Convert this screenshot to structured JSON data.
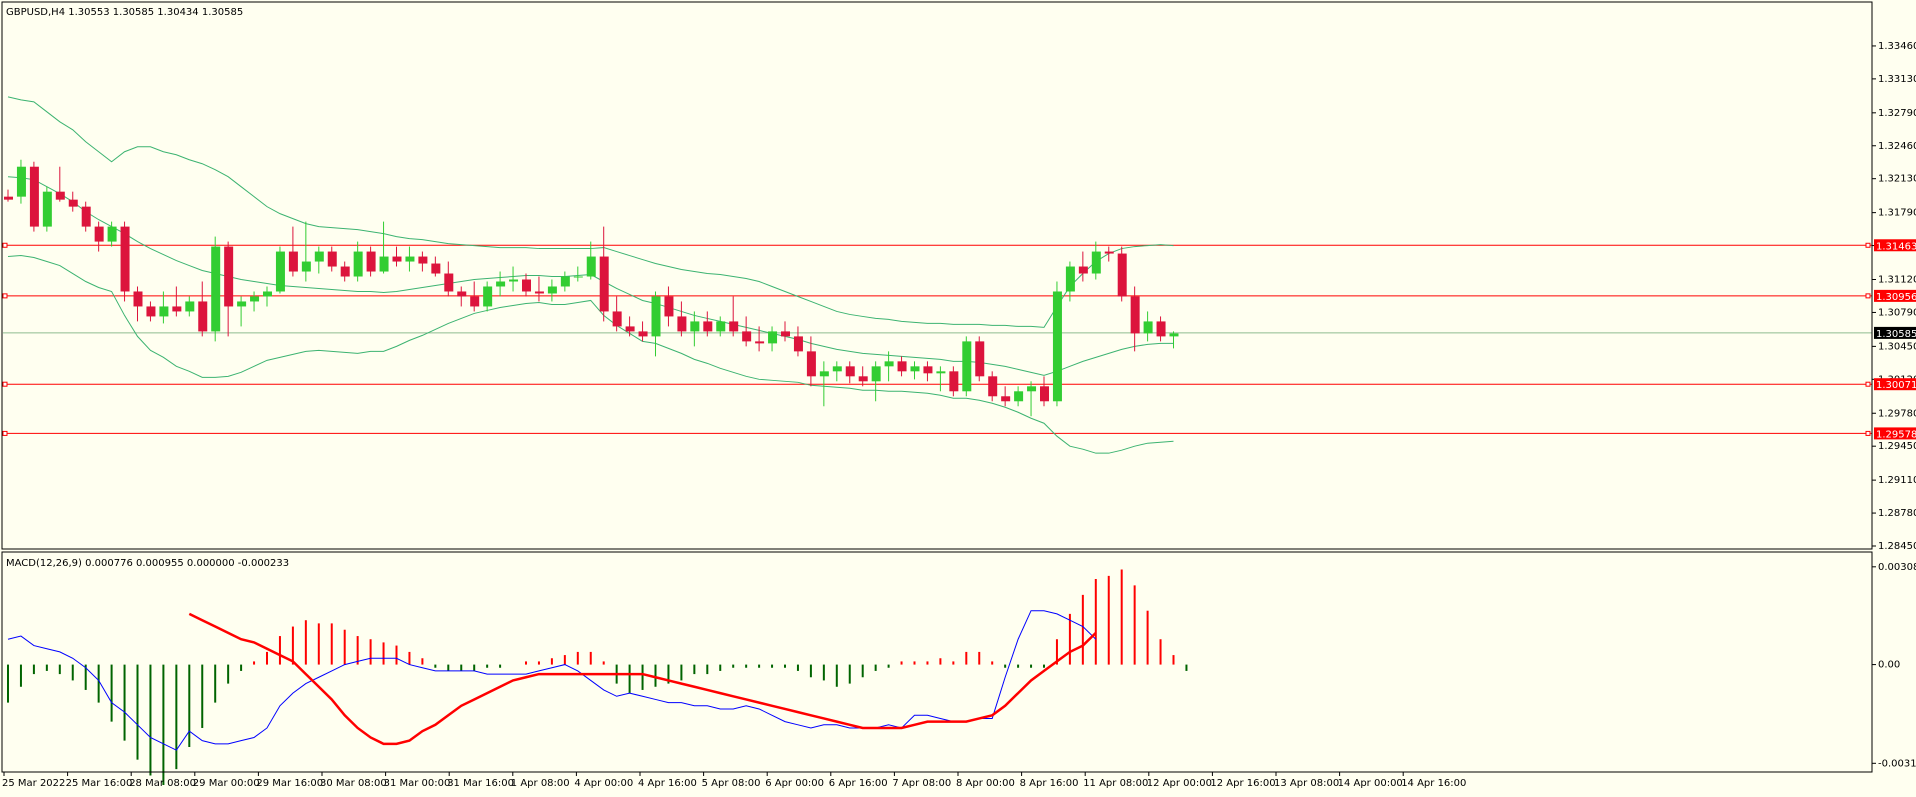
{
  "header": {
    "symbol_line": "GBPUSD,H4  1.30553 1.30585 1.30434 1.30585",
    "macd_line": "MACD(12,26,9) 0.000776 0.000955 0.000000 -0.000233"
  },
  "colors": {
    "background": "#fffff0",
    "frame": "#000000",
    "bull": "#32cd32",
    "bear": "#dc143c",
    "bands": "#3cb371",
    "hline": "#ff0000",
    "bid_line": "#8fbc8f",
    "macd_main": "#0000ff",
    "macd_signal": "#ff0000",
    "hist_down": "#006400",
    "hist_up": "#ff0000"
  },
  "chart_data": [
    {
      "type": "candlestick",
      "title": "GBPUSD,H4",
      "ohlc_header": "1.30553 1.30585 1.30434 1.30585",
      "ylim": [
        1.2845,
        1.3375
      ],
      "y_ticks": [
        "1.33460",
        "1.33130",
        "1.32790",
        "1.32460",
        "1.32130",
        "1.31790",
        "1.31460",
        "1.31120",
        "1.30790",
        "1.30450",
        "1.30120",
        "1.29780",
        "1.29450",
        "1.29110",
        "1.28780",
        "1.28450"
      ],
      "x_ticks": [
        "25 Mar 2022",
        "25 Mar 16:00",
        "28 Mar 08:00",
        "29 Mar 00:00",
        "29 Mar 16:00",
        "30 Mar 08:00",
        "31 Mar 00:00",
        "31 Mar 16:00",
        "1 Apr 08:00",
        "4 Apr 00:00",
        "4 Apr 16:00",
        "5 Apr 08:00",
        "6 Apr 00:00",
        "6 Apr 16:00",
        "7 Apr 08:00",
        "8 Apr 00:00",
        "8 Apr 16:00",
        "11 Apr 08:00",
        "12 Apr 00:00",
        "12 Apr 16:00",
        "13 Apr 08:00",
        "14 Apr 00:00",
        "14 Apr 16:00"
      ],
      "current_price": "1.30585",
      "horizontal_levels": [
        "1.31463",
        "1.30956",
        "1.30071",
        "1.29578"
      ],
      "candles": [
        [
          1.3195,
          1.3202,
          1.319,
          1.3192
        ],
        [
          1.3195,
          1.3232,
          1.3188,
          1.3225
        ],
        [
          1.3225,
          1.323,
          1.316,
          1.3165
        ],
        [
          1.3165,
          1.3205,
          1.316,
          1.32
        ],
        [
          1.32,
          1.3225,
          1.319,
          1.3192
        ],
        [
          1.3192,
          1.32,
          1.318,
          1.3185
        ],
        [
          1.3185,
          1.319,
          1.316,
          1.3165
        ],
        [
          1.3165,
          1.317,
          1.314,
          1.315
        ],
        [
          1.315,
          1.317,
          1.3145,
          1.3165
        ],
        [
          1.3165,
          1.317,
          1.309,
          1.31
        ],
        [
          1.31,
          1.3105,
          1.307,
          1.3085
        ],
        [
          1.3085,
          1.309,
          1.307,
          1.3075
        ],
        [
          1.3075,
          1.31,
          1.3068,
          1.3085
        ],
        [
          1.3085,
          1.3105,
          1.3075,
          1.308
        ],
        [
          1.308,
          1.3095,
          1.3075,
          1.309
        ],
        [
          1.309,
          1.311,
          1.3055,
          1.306
        ],
        [
          1.306,
          1.3155,
          1.305,
          1.3145
        ],
        [
          1.3145,
          1.315,
          1.3055,
          1.3085
        ],
        [
          1.3085,
          1.3095,
          1.3065,
          1.309
        ],
        [
          1.309,
          1.31,
          1.308,
          1.3095
        ],
        [
          1.3095,
          1.3105,
          1.3085,
          1.31
        ],
        [
          1.31,
          1.3145,
          1.3098,
          1.314
        ],
        [
          1.314,
          1.3165,
          1.3115,
          1.312
        ],
        [
          1.312,
          1.317,
          1.311,
          1.313
        ],
        [
          1.313,
          1.3145,
          1.3118,
          1.314
        ],
        [
          1.314,
          1.3145,
          1.312,
          1.3125
        ],
        [
          1.3125,
          1.313,
          1.311,
          1.3115
        ],
        [
          1.3115,
          1.315,
          1.311,
          1.314
        ],
        [
          1.314,
          1.3145,
          1.3115,
          1.312
        ],
        [
          1.312,
          1.317,
          1.3118,
          1.3135
        ],
        [
          1.3135,
          1.3145,
          1.3125,
          1.313
        ],
        [
          1.313,
          1.3145,
          1.312,
          1.3135
        ],
        [
          1.3135,
          1.314,
          1.312,
          1.3128
        ],
        [
          1.3128,
          1.3135,
          1.3115,
          1.3118
        ],
        [
          1.3118,
          1.313,
          1.3095,
          1.31
        ],
        [
          1.31,
          1.3105,
          1.3085,
          1.3095
        ],
        [
          1.3095,
          1.311,
          1.308,
          1.3085
        ],
        [
          1.3085,
          1.311,
          1.308,
          1.3105
        ],
        [
          1.3105,
          1.312,
          1.3095,
          1.311
        ],
        [
          1.311,
          1.3125,
          1.31,
          1.3112
        ],
        [
          1.3112,
          1.3118,
          1.3095,
          1.31
        ],
        [
          1.31,
          1.3115,
          1.309,
          1.3098
        ],
        [
          1.3098,
          1.3112,
          1.309,
          1.3105
        ],
        [
          1.3105,
          1.312,
          1.31,
          1.3115
        ],
        [
          1.3115,
          1.3125,
          1.311,
          1.3115
        ],
        [
          1.3115,
          1.315,
          1.3112,
          1.3135
        ],
        [
          1.3135,
          1.3165,
          1.307,
          1.308
        ],
        [
          1.308,
          1.3095,
          1.306,
          1.3065
        ],
        [
          1.3065,
          1.3075,
          1.3055,
          1.306
        ],
        [
          1.306,
          1.307,
          1.305,
          1.3055
        ],
        [
          1.3055,
          1.31,
          1.3035,
          1.3095
        ],
        [
          1.3095,
          1.3105,
          1.3065,
          1.3075
        ],
        [
          1.3075,
          1.309,
          1.3055,
          1.306
        ],
        [
          1.306,
          1.308,
          1.3045,
          1.307
        ],
        [
          1.307,
          1.308,
          1.3055,
          1.306
        ],
        [
          1.306,
          1.3075,
          1.3055,
          1.307
        ],
        [
          1.307,
          1.3095,
          1.3055,
          1.306
        ],
        [
          1.306,
          1.3075,
          1.3045,
          1.305
        ],
        [
          1.305,
          1.3065,
          1.304,
          1.3048
        ],
        [
          1.3048,
          1.3065,
          1.304,
          1.306
        ],
        [
          1.306,
          1.307,
          1.305,
          1.3055
        ],
        [
          1.3055,
          1.3065,
          1.3035,
          1.304
        ],
        [
          1.304,
          1.3055,
          1.3005,
          1.3015
        ],
        [
          1.3015,
          1.303,
          1.2985,
          1.302
        ],
        [
          1.302,
          1.303,
          1.301,
          1.3025
        ],
        [
          1.3025,
          1.303,
          1.3008,
          1.3015
        ],
        [
          1.3015,
          1.3025,
          1.3005,
          1.301
        ],
        [
          1.301,
          1.303,
          1.299,
          1.3025
        ],
        [
          1.3025,
          1.304,
          1.301,
          1.303
        ],
        [
          1.303,
          1.3035,
          1.3015,
          1.302
        ],
        [
          1.302,
          1.303,
          1.3012,
          1.3025
        ],
        [
          1.3025,
          1.303,
          1.301,
          1.3018
        ],
        [
          1.3018,
          1.3025,
          1.3,
          1.302
        ],
        [
          1.302,
          1.3025,
          1.2995,
          1.3
        ],
        [
          1.3,
          1.3055,
          1.2995,
          1.305
        ],
        [
          1.305,
          1.3055,
          1.301,
          1.3015
        ],
        [
          1.3015,
          1.302,
          1.299,
          1.2995
        ],
        [
          1.2995,
          1.3005,
          1.2985,
          1.299
        ],
        [
          1.299,
          1.3005,
          1.2985,
          1.3
        ],
        [
          1.3,
          1.301,
          1.2975,
          1.3005
        ],
        [
          1.3005,
          1.3015,
          1.2985,
          1.299
        ],
        [
          1.299,
          1.311,
          1.2985,
          1.31
        ],
        [
          1.31,
          1.313,
          1.309,
          1.3125
        ],
        [
          1.3125,
          1.314,
          1.311,
          1.3118
        ],
        [
          1.3118,
          1.315,
          1.3112,
          1.314
        ],
        [
          1.314,
          1.3145,
          1.313,
          1.3138
        ],
        [
          1.3138,
          1.3145,
          1.309,
          1.3095
        ],
        [
          1.3095,
          1.3105,
          1.304,
          1.3058
        ],
        [
          1.3058,
          1.308,
          1.305,
          1.307
        ],
        [
          1.307,
          1.3075,
          1.305,
          1.3055
        ],
        [
          1.3055,
          1.306,
          1.3043,
          1.3058
        ]
      ],
      "bands": {
        "upper": [
          1.3295,
          1.3292,
          1.329,
          1.328,
          1.327,
          1.3262,
          1.325,
          1.324,
          1.323,
          1.324,
          1.3245,
          1.3245,
          1.324,
          1.3237,
          1.3232,
          1.3228,
          1.3222,
          1.3215,
          1.3205,
          1.3195,
          1.3185,
          1.3178,
          1.3173,
          1.3168,
          1.3165,
          1.3164,
          1.3163,
          1.3162,
          1.316,
          1.3158,
          1.3155,
          1.3153,
          1.3152,
          1.315,
          1.3148,
          1.3147,
          1.3146,
          1.3145,
          1.3144,
          1.3144,
          1.3144,
          1.3143,
          1.3143,
          1.3143,
          1.3143,
          1.3143,
          1.3144,
          1.314,
          1.3136,
          1.3132,
          1.3128,
          1.3125,
          1.3122,
          1.312,
          1.3118,
          1.3117,
          1.3115,
          1.3113,
          1.311,
          1.3105,
          1.31,
          1.3095,
          1.309,
          1.3085,
          1.308,
          1.3077,
          1.3075,
          1.3073,
          1.3072,
          1.307,
          1.3069,
          1.3068,
          1.3068,
          1.3067,
          1.3067,
          1.3067,
          1.3066,
          1.3066,
          1.3065,
          1.3065,
          1.3064,
          1.3085,
          1.3105,
          1.3118,
          1.313,
          1.3138,
          1.3143,
          1.3145,
          1.3146,
          1.3147,
          1.3146
        ],
        "middle": [
          1.3215,
          1.3214,
          1.3212,
          1.3205,
          1.3198,
          1.319,
          1.318,
          1.3172,
          1.3165,
          1.3158,
          1.315,
          1.3143,
          1.3137,
          1.3131,
          1.3126,
          1.3121,
          1.3118,
          1.3115,
          1.3112,
          1.311,
          1.3108,
          1.3106,
          1.3105,
          1.3104,
          1.3103,
          1.3102,
          1.3101,
          1.31,
          1.31,
          1.3099,
          1.31,
          1.3102,
          1.3104,
          1.3106,
          1.3108,
          1.311,
          1.3112,
          1.3113,
          1.3114,
          1.3115,
          1.3116,
          1.3116,
          1.3115,
          1.3115,
          1.3116,
          1.3117,
          1.311,
          1.3103,
          1.3097,
          1.3091,
          1.3088,
          1.3084,
          1.308,
          1.3076,
          1.3073,
          1.307,
          1.3067,
          1.3064,
          1.3061,
          1.3058,
          1.3055,
          1.3052,
          1.3048,
          1.3045,
          1.3042,
          1.304,
          1.3038,
          1.3037,
          1.3036,
          1.3035,
          1.3034,
          1.3033,
          1.3032,
          1.303,
          1.303,
          1.3029,
          1.3027,
          1.3025,
          1.3022,
          1.3019,
          1.3016,
          1.302,
          1.3025,
          1.303,
          1.3034,
          1.3038,
          1.3042,
          1.3045,
          1.3047,
          1.3048,
          1.3048
        ],
        "lower": [
          1.3135,
          1.3136,
          1.3134,
          1.313,
          1.3126,
          1.3118,
          1.311,
          1.3104,
          1.31,
          1.3076,
          1.3055,
          1.3041,
          1.3034,
          1.3025,
          1.302,
          1.3014,
          1.3014,
          1.3015,
          1.3019,
          1.3025,
          1.3031,
          1.3034,
          1.3037,
          1.304,
          1.3041,
          1.304,
          1.3039,
          1.3038,
          1.304,
          1.304,
          1.3045,
          1.3051,
          1.3056,
          1.3062,
          1.3068,
          1.3073,
          1.3078,
          1.3081,
          1.3084,
          1.3086,
          1.3088,
          1.3089,
          1.3087,
          1.3087,
          1.3089,
          1.3091,
          1.3076,
          1.3066,
          1.3058,
          1.305,
          1.3048,
          1.3043,
          1.3038,
          1.3032,
          1.3028,
          1.3023,
          1.3019,
          1.3015,
          1.3012,
          1.3011,
          1.301,
          1.3009,
          1.3006,
          1.3005,
          1.3004,
          1.3003,
          1.3001,
          1.3001,
          1.3,
          1.3,
          1.2999,
          1.2998,
          1.2996,
          1.2993,
          1.2993,
          1.2991,
          1.2988,
          1.2984,
          1.2979,
          1.2973,
          1.2968,
          1.2955,
          1.2945,
          1.2942,
          1.2938,
          1.2938,
          1.2941,
          1.2945,
          1.2948,
          1.2949,
          1.295
        ]
      }
    },
    {
      "type": "macd",
      "title": "MACD(12,26,9)",
      "values_header": "0.000776 0.000955 0.000000 -0.000233",
      "ylim": [
        -0.0032,
        0.0033
      ],
      "y_ticks": [
        "0.003085",
        "0.00",
        "-0.003115"
      ],
      "histogram": [
        -0.0012,
        -0.0007,
        -0.0003,
        -0.0002,
        -0.0003,
        -0.0005,
        -0.0008,
        -0.0012,
        -0.0018,
        -0.0024,
        -0.003,
        -0.0035,
        -0.0038,
        -0.0033,
        -0.0026,
        -0.002,
        -0.0012,
        -0.0006,
        -0.0002,
        0.0001,
        0.0004,
        0.0009,
        0.0012,
        0.0014,
        0.0013,
        0.0013,
        0.0011,
        0.0009,
        0.0008,
        0.0007,
        0.0006,
        0.0004,
        0.0002,
        -0.0001,
        -0.0002,
        -0.0002,
        -0.0002,
        -0.0001,
        -0.0001,
        0.0,
        0.0001,
        0.0001,
        0.0002,
        0.0003,
        0.0004,
        0.0004,
        0.0001,
        -0.0006,
        -0.0009,
        -0.0008,
        -0.0007,
        -0.0006,
        -0.0005,
        -0.0003,
        -0.0003,
        -0.0002,
        -0.0001,
        -0.0001,
        -0.0001,
        -0.0001,
        -0.0001,
        -0.0002,
        -0.0004,
        -0.0005,
        -0.0007,
        -0.0006,
        -0.0004,
        -0.0002,
        -0.0001,
        0.0001,
        0.0001,
        0.0001,
        0.0002,
        0.0001,
        0.0004,
        0.0004,
        0.0001,
        -0.0001,
        -0.0001,
        -0.0001,
        -0.0001,
        0.0008,
        0.0016,
        0.0022,
        0.0027,
        0.0028,
        0.003,
        0.0025,
        0.0017,
        0.0008,
        0.0003,
        -0.0002
      ],
      "main": [
        0.0008,
        0.0009,
        0.0006,
        0.0005,
        0.0004,
        0.0002,
        -0.0001,
        -0.0005,
        -0.0012,
        -0.0015,
        -0.0019,
        -0.0023,
        -0.0025,
        -0.0027,
        -0.0021,
        -0.0024,
        -0.0025,
        -0.0025,
        -0.0024,
        -0.0023,
        -0.002,
        -0.0013,
        -0.0009,
        -0.0006,
        -0.0004,
        -0.0002,
        0.0,
        0.0001,
        0.0002,
        0.0002,
        0.0002,
        0.0,
        -0.0001,
        -0.0002,
        -0.0002,
        -0.0002,
        -0.0002,
        -0.0003,
        -0.0003,
        -0.0003,
        -0.0003,
        -0.0002,
        -0.0001,
        0.0,
        -0.0002,
        -0.0005,
        -0.0008,
        -0.001,
        -0.0009,
        -0.001,
        -0.0011,
        -0.0012,
        -0.0012,
        -0.0013,
        -0.0013,
        -0.0014,
        -0.0014,
        -0.0013,
        -0.0014,
        -0.0016,
        -0.0018,
        -0.0019,
        -0.002,
        -0.0019,
        -0.0019,
        -0.002,
        -0.002,
        -0.002,
        -0.0019,
        -0.002,
        -0.0016,
        -0.0016,
        -0.0017,
        -0.0018,
        -0.0018,
        -0.0017,
        -0.0017,
        -0.0004,
        0.0008,
        0.0017,
        0.0017,
        0.0016,
        0.0014,
        0.0012,
        0.0008
      ],
      "signal": [
        0.0016,
        0.0014,
        0.0012,
        0.001,
        0.0008,
        0.0007,
        0.0005,
        0.0003,
        0.0001,
        -0.0003,
        -0.0007,
        -0.0011,
        -0.0016,
        -0.002,
        -0.0023,
        -0.0025,
        -0.0025,
        -0.0024,
        -0.0021,
        -0.0019,
        -0.0016,
        -0.0013,
        -0.0011,
        -0.0009,
        -0.0007,
        -0.0005,
        -0.0004,
        -0.0003,
        -0.0003,
        -0.0003,
        -0.0003,
        -0.0003,
        -0.0003,
        -0.0003,
        -0.0003,
        -0.0003,
        -0.0004,
        -0.0005,
        -0.0006,
        -0.0007,
        -0.0008,
        -0.0009,
        -0.001,
        -0.0011,
        -0.0012,
        -0.0013,
        -0.0014,
        -0.0015,
        -0.0016,
        -0.0017,
        -0.0018,
        -0.0019,
        -0.002,
        -0.002,
        -0.002,
        -0.002,
        -0.0019,
        -0.0018,
        -0.0018,
        -0.0018,
        -0.0018,
        -0.0017,
        -0.0016,
        -0.0013,
        -0.0009,
        -0.0005,
        -0.0002,
        0.0001,
        0.0004,
        0.0006,
        0.001
      ]
    }
  ]
}
